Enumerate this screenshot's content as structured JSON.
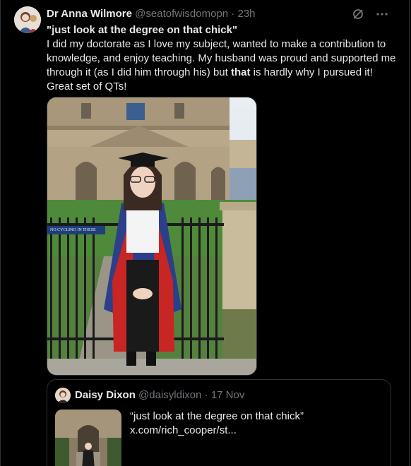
{
  "tweet": {
    "author_name": "Dr Anna Wilmore",
    "author_handle": "@seatofwisdomopn",
    "separator": "·",
    "time": "23h",
    "quote_line": "\"just look at the degree on that chick\"",
    "text_before": "I did my doctorate as I love my subject, wanted to make a contribution to knowledge, and enjoy teaching. My husband was proud and supported me through it (as I did him through his) but ",
    "text_bold": "that",
    "text_after": " is hardly why I pursued it! Great set of QTs!",
    "photo_sign_text": "NO CYCLING IN THESE",
    "icons": {
      "grok": "grok-icon",
      "more": "more-icon"
    }
  },
  "quoted_tweet": {
    "author_name": "Daisy Dixon",
    "author_handle": "@daisyldixon",
    "separator": "·",
    "date": "17 Nov",
    "text": "“just look at the degree on that chick”",
    "link": "x.com/rich_cooper/st..."
  },
  "colors": {
    "background": "#000000",
    "text": "#e7e9ea",
    "secondary": "#71767b",
    "border": "#2f3336"
  }
}
